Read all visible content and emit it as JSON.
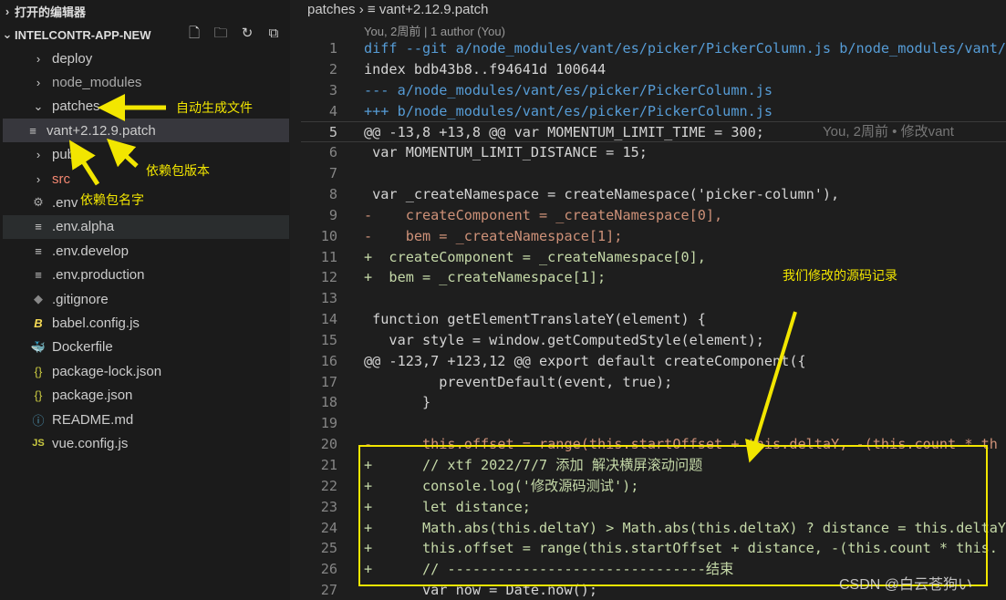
{
  "sidebar": {
    "open_editors_label": "打开的编辑器",
    "project_name": "INTELCONTR-APP-NEW",
    "header_icons": [
      "new-file-icon",
      "new-folder-icon",
      "refresh-icon",
      "collapse-all-icon"
    ],
    "items": [
      {
        "label": "deploy",
        "type": "folder",
        "expanded": false
      },
      {
        "label": "node_modules",
        "type": "folder",
        "expanded": false
      },
      {
        "label": "patches",
        "type": "folder",
        "expanded": true
      },
      {
        "label": "vant+2.12.9.patch",
        "type": "file",
        "icon": "lines-icon",
        "selected": true
      },
      {
        "label": "public",
        "type": "folder",
        "expanded": false
      },
      {
        "label": "src",
        "type": "folder",
        "expanded": false
      },
      {
        "label": ".env",
        "type": "file",
        "icon": "gear-icon"
      },
      {
        "label": ".env.alpha",
        "type": "file",
        "icon": "lines-icon",
        "hover": true
      },
      {
        "label": ".env.develop",
        "type": "file",
        "icon": "lines-icon"
      },
      {
        "label": ".env.production",
        "type": "file",
        "icon": "lines-icon"
      },
      {
        "label": ".gitignore",
        "type": "file",
        "icon": "git-icon"
      },
      {
        "label": "babel.config.js",
        "type": "file",
        "icon": "babel-icon"
      },
      {
        "label": "Dockerfile",
        "type": "file",
        "icon": "docker-icon"
      },
      {
        "label": "package-lock.json",
        "type": "file",
        "icon": "json-icon"
      },
      {
        "label": "package.json",
        "type": "file",
        "icon": "json-icon"
      },
      {
        "label": "README.md",
        "type": "file",
        "icon": "info-icon"
      },
      {
        "label": "vue.config.js",
        "type": "file",
        "icon": "js-icon"
      }
    ]
  },
  "editor": {
    "breadcrumb": [
      "patches",
      "vant+2.12.9.patch"
    ],
    "codelens": "You, 2周前 | 1 author (You)",
    "blame": "You, 2周前 • 修改vant",
    "active_line": 5,
    "lines": [
      {
        "n": "1",
        "kind": "meta",
        "text": "diff --git a/node_modules/vant/es/picker/PickerColumn.js b/node_modules/vant/"
      },
      {
        "n": "2",
        "kind": "plain",
        "text": "index bdb43b8..f94641d 100644"
      },
      {
        "n": "3",
        "kind": "meta",
        "text": "--- a/node_modules/vant/es/picker/PickerColumn.js"
      },
      {
        "n": "4",
        "kind": "meta",
        "text": "+++ b/node_modules/vant/es/picker/PickerColumn.js"
      },
      {
        "n": "5",
        "kind": "hunk",
        "text": "@@ -13,8 +13,8 @@ var MOMENTUM_LIMIT_TIME = 300;"
      },
      {
        "n": "6",
        "kind": "plain",
        "text": " var MOMENTUM_LIMIT_DISTANCE = 15;"
      },
      {
        "n": "7",
        "kind": "plain",
        "text": ""
      },
      {
        "n": "8",
        "kind": "plain",
        "text": " var _createNamespace = createNamespace('picker-column'),"
      },
      {
        "n": "9",
        "kind": "removed",
        "text": "-    createComponent = _createNamespace[0],"
      },
      {
        "n": "10",
        "kind": "removed",
        "text": "-    bem = _createNamespace[1];"
      },
      {
        "n": "11",
        "kind": "added",
        "text": "+  createComponent = _createNamespace[0],"
      },
      {
        "n": "12",
        "kind": "added",
        "text": "+  bem = _createNamespace[1];"
      },
      {
        "n": "13",
        "kind": "plain",
        "text": ""
      },
      {
        "n": "14",
        "kind": "plain",
        "text": " function getElementTranslateY(element) {"
      },
      {
        "n": "15",
        "kind": "plain",
        "text": "   var style = window.getComputedStyle(element);"
      },
      {
        "n": "16",
        "kind": "hunk",
        "text": "@@ -123,7 +123,12 @@ export default createComponent({"
      },
      {
        "n": "17",
        "kind": "plain",
        "text": "         preventDefault(event, true);"
      },
      {
        "n": "18",
        "kind": "plain",
        "text": "       }"
      },
      {
        "n": "19",
        "kind": "plain",
        "text": ""
      },
      {
        "n": "20",
        "kind": "removed",
        "text": "-      this.offset = range(this.startOffset + this.deltaY, -(this.count * th"
      },
      {
        "n": "21",
        "kind": "added",
        "text": "+      // xtf 2022/7/7 添加 解决横屏滚动问题"
      },
      {
        "n": "22",
        "kind": "added",
        "text": "+      console.log('修改源码测试');"
      },
      {
        "n": "23",
        "kind": "added",
        "text": "+      let distance;"
      },
      {
        "n": "24",
        "kind": "added",
        "text": "+      Math.abs(this.deltaY) > Math.abs(this.deltaX) ? distance = this.deltaY"
      },
      {
        "n": "25",
        "kind": "added",
        "text": "+      this.offset = range(this.startOffset + distance, -(this.count * this."
      },
      {
        "n": "26",
        "kind": "added",
        "text": "+      // -------------------------------结束"
      },
      {
        "n": "27",
        "kind": "plain",
        "text": "       var now = Date.now();"
      }
    ]
  },
  "annotations": {
    "auto_generated": "自动生成文件",
    "package_version": "依赖包版本",
    "package_name": "依赖包名字",
    "modified_source": "我们修改的源码记录",
    "color": "#f2e600"
  },
  "watermark": "CSDN @白云苍狗い"
}
